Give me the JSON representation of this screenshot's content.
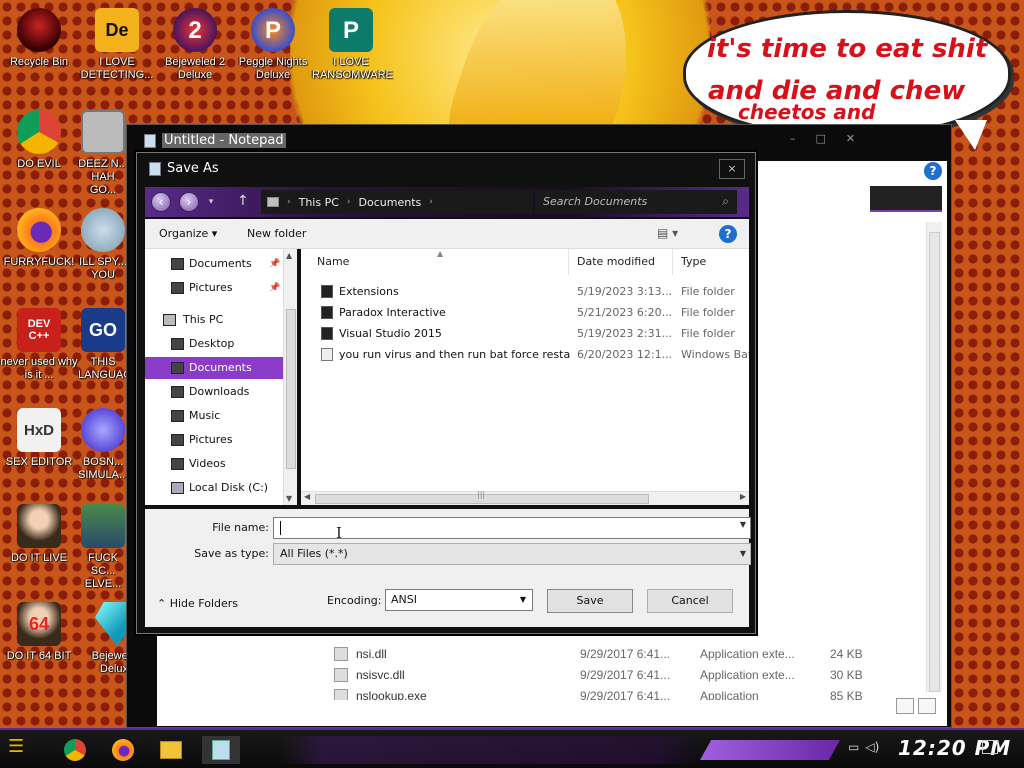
{
  "desktop": {
    "speech_lines": [
      "it's time to eat shit",
      "and die and chew",
      "cheetos and"
    ],
    "icons": [
      {
        "label": "Recycle Bin",
        "icon": "recycle-bin-icon"
      },
      {
        "label": "I LOVE DETECTING...",
        "icon": "detect-it-easy-icon",
        "glyph": "De"
      },
      {
        "label": "Bejeweled 2 Deluxe",
        "icon": "bejeweled-2-icon",
        "glyph": "2"
      },
      {
        "label": "Peggle Nights Deluxe",
        "icon": "peggle-nights-icon",
        "glyph": "P"
      },
      {
        "label": "I LOVE RANSOMWARE",
        "icon": "publisher-icon",
        "glyph": "P"
      },
      {
        "label": "DO EVIL",
        "icon": "chrome-icon"
      },
      {
        "label": "DEEZ N... HAH GO...",
        "icon": "copy-stack-icon"
      },
      {
        "label": "FURRYFUCK!",
        "icon": "firefox-icon"
      },
      {
        "label": "ILL SPY... YOU",
        "icon": "spy-icon"
      },
      {
        "label": "never used why is it ...",
        "icon": "dev-cpp-icon",
        "glyph": "DEV C++"
      },
      {
        "label": "THIS LANGUAG...",
        "icon": "go-language-icon",
        "glyph": "GO"
      },
      {
        "label": "SEX EDITOR",
        "icon": "hxd-icon",
        "glyph": "HxD"
      },
      {
        "label": "BOSN... SIMULA...",
        "icon": "blob-simulator-icon"
      },
      {
        "label": "DO IT LIVE",
        "icon": "portrait-icon"
      },
      {
        "label": "FUCK SC... ELVE...",
        "icon": "game-icon"
      },
      {
        "label": "DO IT 64 BIT",
        "icon": "portrait-64-icon",
        "glyph": "64"
      },
      {
        "label": "Bejeweled Deluxe",
        "icon": "bejeweled-icon"
      }
    ]
  },
  "notepad": {
    "title": "Untitled - Notepad"
  },
  "background_files": [
    {
      "name": "nsi.dll",
      "date": "9/29/2017 6:41...",
      "type": "Application exte...",
      "size": "24 KB"
    },
    {
      "name": "nsisvc.dll",
      "date": "9/29/2017 6:41...",
      "type": "Application exte...",
      "size": "30 KB"
    },
    {
      "name": "nslookup.exe",
      "date": "9/29/2017 6:41...",
      "type": "Application",
      "size": "85 KB"
    }
  ],
  "dialog": {
    "title": "Save As",
    "close": "×",
    "breadcrumb": [
      "This PC",
      "Documents"
    ],
    "search_placeholder": "Search Documents",
    "toolbar": {
      "organize": "Organize ▾",
      "new_folder": "New folder",
      "help": "?"
    },
    "nav": [
      {
        "label": "Documents",
        "pinned": true
      },
      {
        "label": "Pictures",
        "pinned": true
      },
      {
        "label": "This PC"
      },
      {
        "label": "Desktop"
      },
      {
        "label": "Documents",
        "selected": true
      },
      {
        "label": "Downloads"
      },
      {
        "label": "Music"
      },
      {
        "label": "Pictures"
      },
      {
        "label": "Videos"
      },
      {
        "label": "Local Disk (C:)"
      }
    ],
    "columns": [
      "Name",
      "Date modified",
      "Type"
    ],
    "files": [
      {
        "name": "Extensions",
        "date": "5/19/2023 3:13...",
        "type": "File folder"
      },
      {
        "name": "Paradox Interactive",
        "date": "5/21/2023 6:20...",
        "type": "File folder"
      },
      {
        "name": "Visual Studio 2015",
        "date": "5/19/2023 2:31...",
        "type": "File folder"
      },
      {
        "name": "you run virus and then run bat force restarte...",
        "date": "6/20/2023 12:1...",
        "type": "Windows Batch"
      }
    ],
    "file_name_label": "File name:",
    "file_name_value": "",
    "save_type_label": "Save as type:",
    "save_type_value": "All Files  (*.*)",
    "hide_folders": "Hide Folders",
    "encoding_label": "Encoding:",
    "encoding_value": "ANSI",
    "save_button": "Save",
    "cancel_button": "Cancel"
  },
  "taskbar": {
    "clock": "12:20 PM"
  }
}
